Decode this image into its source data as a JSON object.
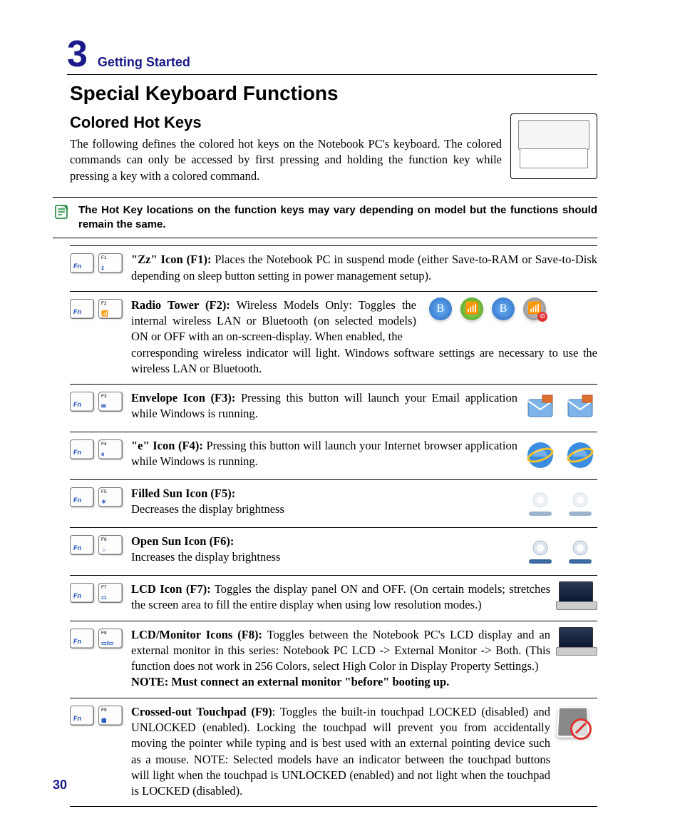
{
  "chapter": {
    "number": "3",
    "title": "Getting Started"
  },
  "h1": "Special Keyboard Functions",
  "h2": "Colored Hot Keys",
  "intro": "The following defines the colored hot keys on the Notebook PC's keyboard. The colored commands can only be accessed by first pressing and holding the function key while pressing a key with a colored command.",
  "note": "The Hot Key locations on the function keys may vary depending on model but the functions should remain the same.",
  "fn_label": "Fn",
  "entries": [
    {
      "fkey": "F1",
      "glyph": "z",
      "lead": "\"Zz\" Icon (F1):",
      "body": " Places the Notebook PC in suspend mode (either Save-to-RAM or Save-to-Disk depending on sleep button setting in power management setup).",
      "note": "",
      "side": "none"
    },
    {
      "fkey": "F2",
      "glyph": "📶",
      "lead": "Radio Tower (F2):",
      "body": " Wireless Models Only: Toggles the internal wireless LAN or Bluetooth (on selected models) ON or OFF with an on-screen-display. When enabled, the corresponding wireless indicator will light. Windows software settings are necessary to use the wireless LAN or Bluetooth.",
      "note": "",
      "side": "wireless"
    },
    {
      "fkey": "F3",
      "glyph": "✉",
      "lead": "Envelope Icon (F3):",
      "body": " Pressing this button will launch your Email application while Windows is running.",
      "note": "",
      "side": "mail"
    },
    {
      "fkey": "F4",
      "glyph": "e",
      "lead": "\"e\" Icon (F4):",
      "body": " Pressing this button will launch your Internet browser application while Windows is running.",
      "note": "",
      "side": "ie"
    },
    {
      "fkey": "F5",
      "glyph": "☀",
      "lead": "Filled Sun Icon (F5):",
      "body": " Decreases the display brightness",
      "note": "",
      "side": "sun-dim",
      "stack": true
    },
    {
      "fkey": "F6",
      "glyph": "☼",
      "lead": "Open Sun Icon (F6):",
      "body": " Increases the display brightness",
      "note": "",
      "side": "sun-bright",
      "stack": true
    },
    {
      "fkey": "F7",
      "glyph": "▭",
      "lead": "LCD Icon (F7):",
      "body": " Toggles the display panel ON and OFF. (On certain models; stretches the screen area to fill the entire display when using low resolution modes.)",
      "note": "",
      "side": "laptop"
    },
    {
      "fkey": "F8",
      "glyph": "▭/▭",
      "lead": "LCD/Monitor Icons (F8):",
      "body": " Toggles between the Notebook PC's LCD display and an external monitor in this series: Notebook PC LCD -> External Monitor -> Both. (This function does not work in 256 Colors, select High Color in Display Property Settings.) ",
      "note": "NOTE: Must connect an external monitor \"before\" booting up.",
      "side": "laptop"
    },
    {
      "fkey": "F9",
      "glyph": "▦",
      "lead": "Crossed-out Touchpad (F9)",
      "body": ": Toggles the built-in touchpad LOCKED (disabled) and UNLOCKED (enabled). Locking the touchpad will prevent you from accidentally moving the pointer while typing and is best used with an external pointing device such as a mouse. NOTE: Selected models have an indicator between the touchpad buttons will light when the touchpad is UNLOCKED (enabled) and not light when the touchpad is LOCKED (disabled).",
      "note": "",
      "side": "touchpad"
    }
  ],
  "page_number": "30"
}
